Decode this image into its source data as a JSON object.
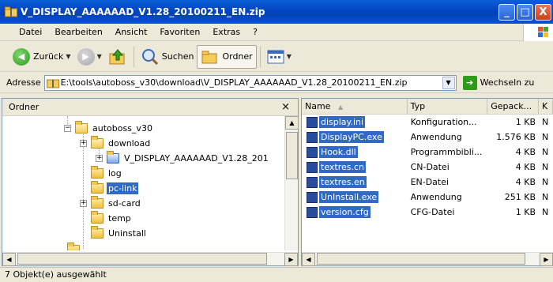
{
  "window": {
    "title": "V_DISPLAY_AAAAAAD_V1.28_20100211_EN.zip",
    "minimize": "_",
    "maximize": "□",
    "close": "X"
  },
  "menu": [
    "Datei",
    "Bearbeiten",
    "Ansicht",
    "Favoriten",
    "Extras",
    "?"
  ],
  "toolbar": {
    "back": "Zurück",
    "search": "Suchen",
    "folders": "Ordner"
  },
  "address": {
    "label": "Adresse",
    "value": "E:\\tools\\autoboss_v30\\download\\V_DISPLAY_AAAAAAD_V1.28_20100211_EN.zip",
    "go": "Wechseln zu"
  },
  "left_pane": {
    "title": "Ordner",
    "close": "×",
    "tree": [
      {
        "label": "autoboss_v30",
        "expander": "−",
        "level": 0
      },
      {
        "label": "download",
        "expander": "+",
        "level": 1
      },
      {
        "label": "V_DISPLAY_AAAAAAD_V1.28_201",
        "expander": "+",
        "level": 2
      },
      {
        "label": "log",
        "expander": "",
        "level": 1
      },
      {
        "label": "pc-link",
        "expander": "",
        "level": 1,
        "selected": true
      },
      {
        "label": "sd-card",
        "expander": "+",
        "level": 1
      },
      {
        "label": "temp",
        "expander": "",
        "level": 1
      },
      {
        "label": "Uninstall",
        "expander": "",
        "level": 1
      }
    ]
  },
  "right_pane": {
    "columns": [
      "Name",
      "Typ",
      "Gepack...",
      "K"
    ],
    "files": [
      {
        "name": "display.ini",
        "type": "Konfiguration...",
        "size": "1 KB",
        "extra": "N"
      },
      {
        "name": "DisplayPC.exe",
        "type": "Anwendung",
        "size": "1.576 KB",
        "extra": "N"
      },
      {
        "name": "Hook.dll",
        "type": "Programmbibli...",
        "size": "4 KB",
        "extra": "N"
      },
      {
        "name": "textres.cn",
        "type": "CN-Datei",
        "size": "4 KB",
        "extra": "N"
      },
      {
        "name": "textres.en",
        "type": "EN-Datei",
        "size": "4 KB",
        "extra": "N"
      },
      {
        "name": "UnInstall.exe",
        "type": "Anwendung",
        "size": "251 KB",
        "extra": "N"
      },
      {
        "name": "version.cfg",
        "type": "CFG-Datei",
        "size": "1 KB",
        "extra": "N"
      }
    ]
  },
  "status": "7 Objekt(e) ausgewählt",
  "colors": {
    "titlebar": "#0446c4",
    "selection": "#316ac5",
    "chrome": "#ece9d8"
  }
}
